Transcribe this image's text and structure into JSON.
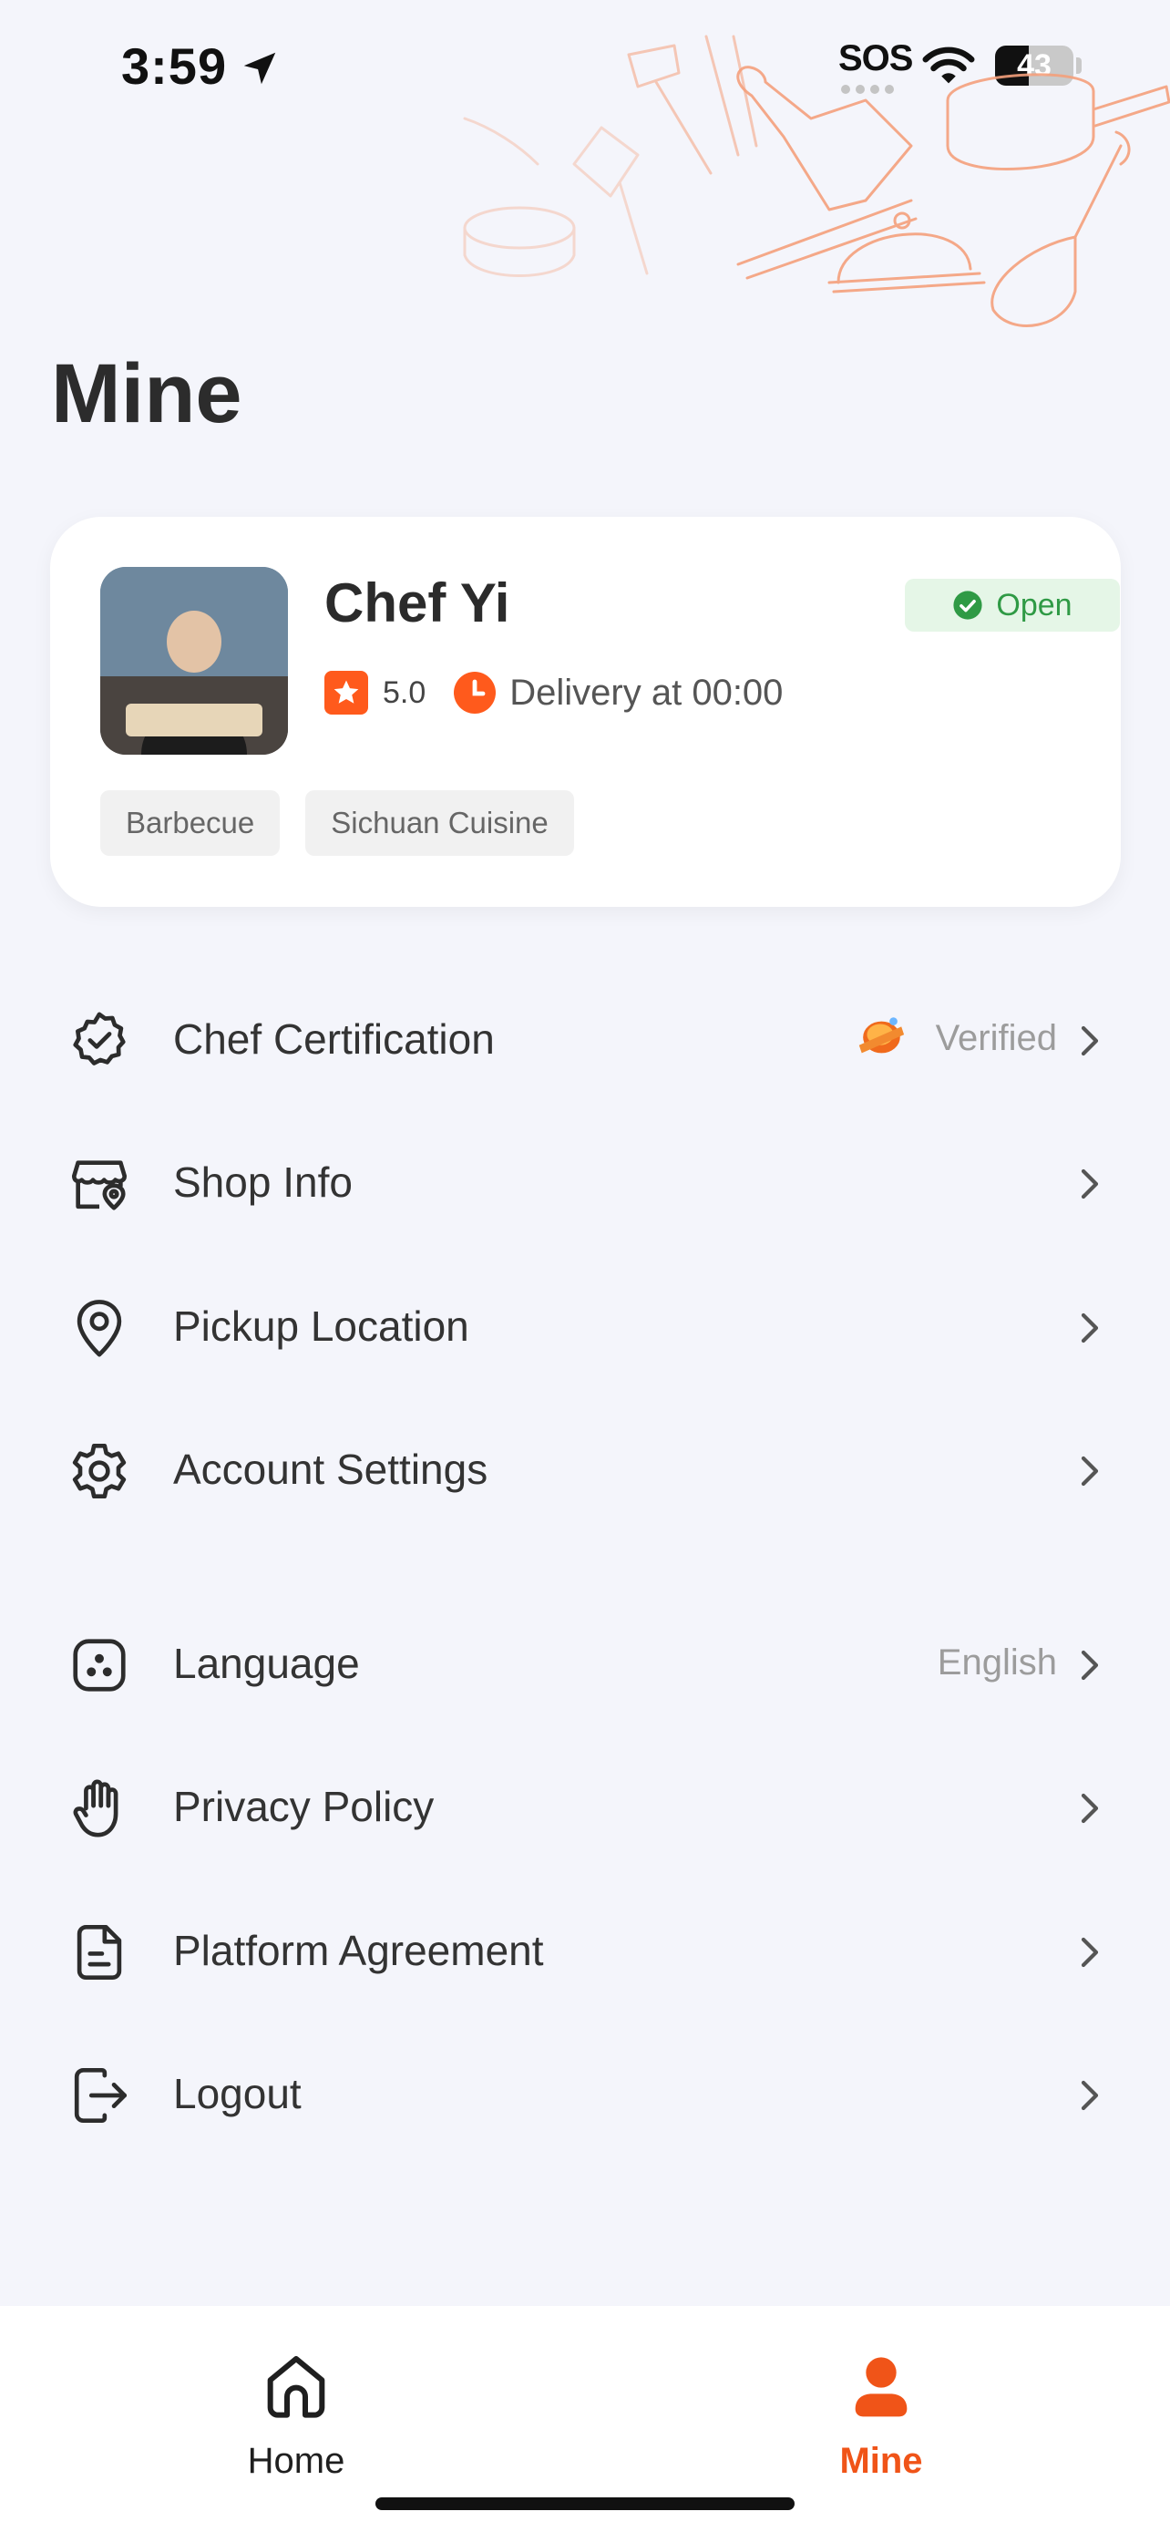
{
  "status_bar": {
    "time": "3:59",
    "sos": "SOS",
    "battery": "43",
    "battery_level": 0.43
  },
  "page": {
    "title": "Mine"
  },
  "profile": {
    "name": "Chef Yi",
    "status": "Open",
    "rating": "5.0",
    "delivery": "Delivery at 00:00",
    "tags": [
      "Barbecue",
      "Sichuan Cuisine"
    ]
  },
  "menu": {
    "group1": [
      {
        "label": "Chef Certification",
        "value": "Verified",
        "icon": "certificate-badge-icon"
      },
      {
        "label": "Shop Info",
        "value": "",
        "icon": "shop-icon"
      },
      {
        "label": "Pickup Location",
        "value": "",
        "icon": "location-pin-icon"
      },
      {
        "label": "Account Settings",
        "value": "",
        "icon": "gear-icon"
      }
    ],
    "group2": [
      {
        "label": "Language",
        "value": "English",
        "icon": "language-icon"
      },
      {
        "label": "Privacy Policy",
        "value": "",
        "icon": "hand-icon"
      },
      {
        "label": "Platform Agreement",
        "value": "",
        "icon": "document-icon"
      },
      {
        "label": "Logout",
        "value": "",
        "icon": "logout-icon"
      }
    ]
  },
  "tabs": [
    {
      "label": "Home",
      "icon": "home-icon",
      "active": false
    },
    {
      "label": "Mine",
      "icon": "user-icon",
      "active": true
    }
  ],
  "colors": {
    "accent": "#f05418",
    "open_green": "#2f9a45",
    "background": "#f4f5fb"
  }
}
